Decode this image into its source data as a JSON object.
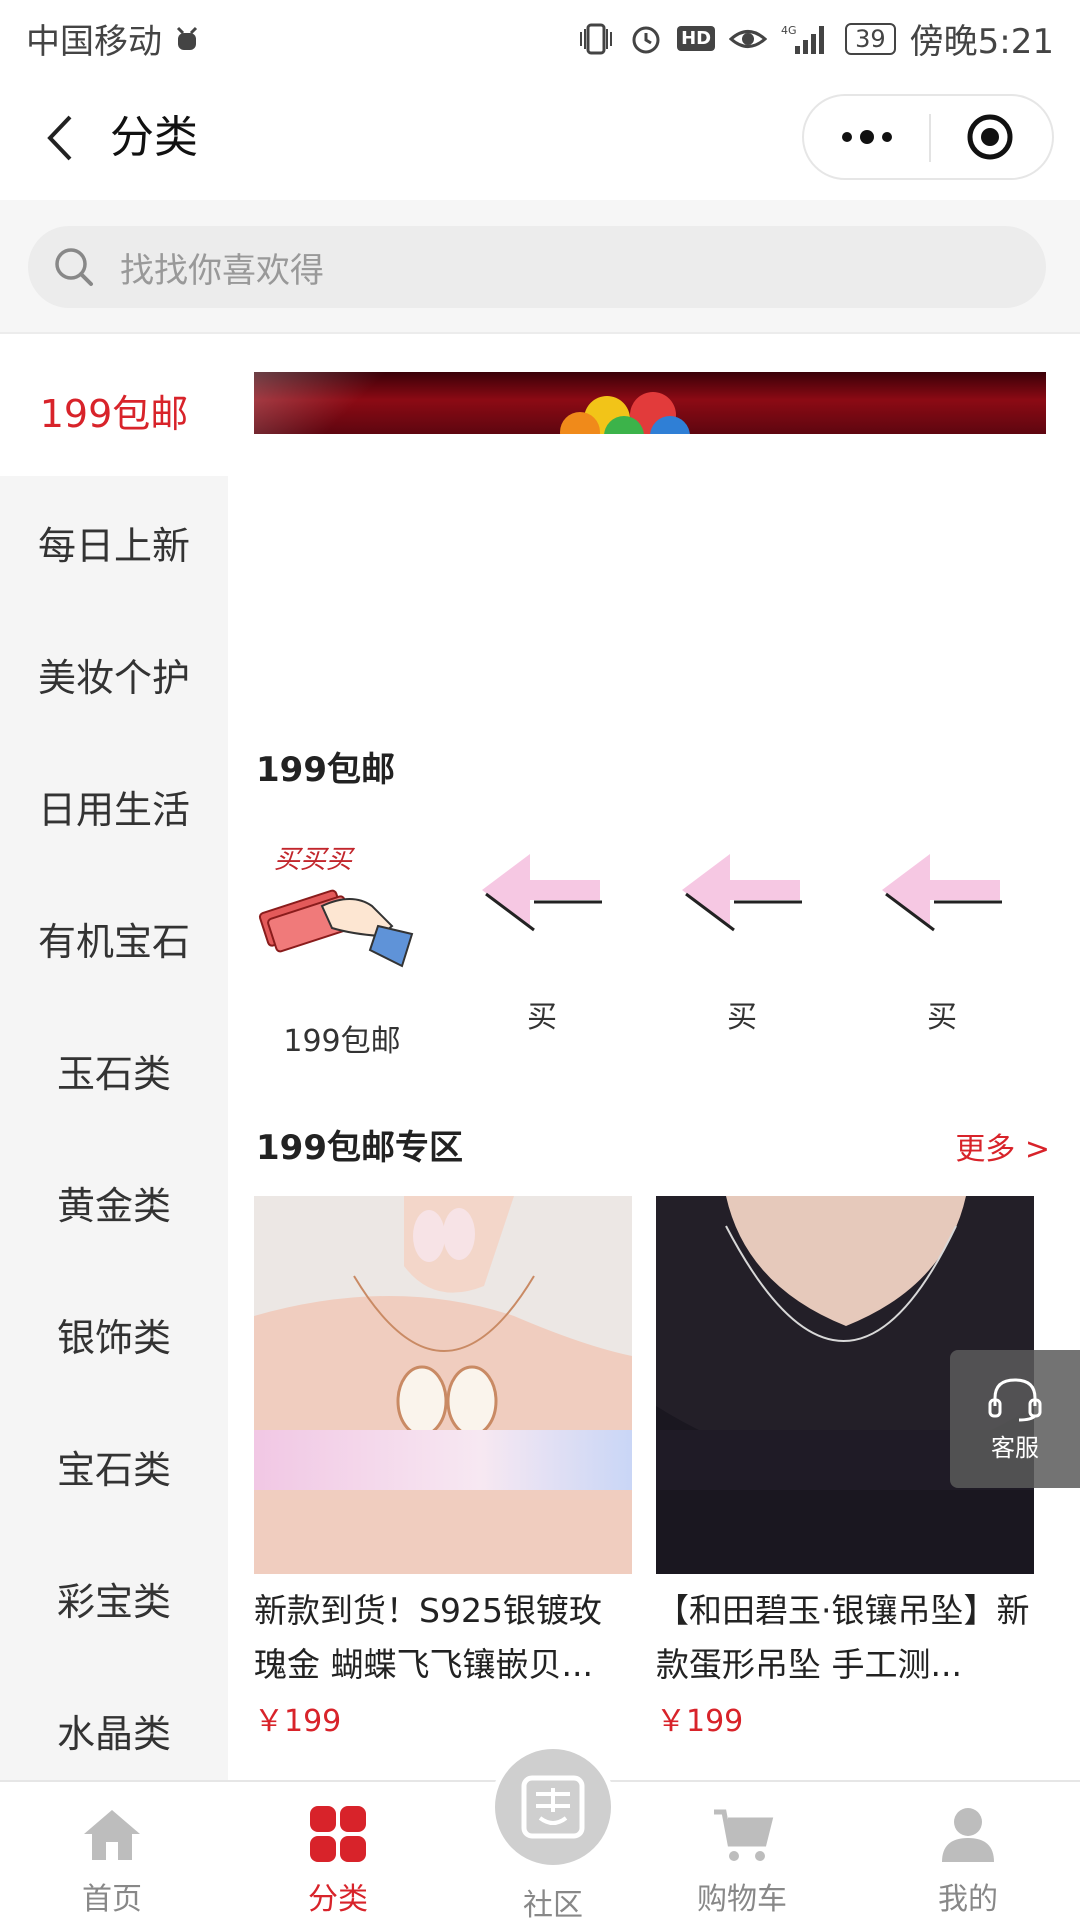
{
  "status_bar": {
    "carrier": "中国移动",
    "battery": "39",
    "time": "傍晚5:21"
  },
  "nav": {
    "title": "分类"
  },
  "search": {
    "placeholder": "找找你喜欢得"
  },
  "sidebar": {
    "items": [
      {
        "label": "199包邮",
        "active": true
      },
      {
        "label": "每日上新"
      },
      {
        "label": "美妆个护"
      },
      {
        "label": "日用生活"
      },
      {
        "label": "有机宝石"
      },
      {
        "label": "玉石类"
      },
      {
        "label": "黄金类"
      },
      {
        "label": "银饰类"
      },
      {
        "label": "宝石类"
      },
      {
        "label": "彩宝类"
      },
      {
        "label": "水晶类"
      }
    ]
  },
  "main": {
    "section1_title": "199包邮",
    "categories": [
      {
        "label": "199包邮",
        "icon": "buy-hand-icon"
      },
      {
        "label": "买",
        "icon": "arrow-left-icon"
      },
      {
        "label": "买",
        "icon": "arrow-left-icon"
      },
      {
        "label": "买",
        "icon": "arrow-left-icon"
      }
    ],
    "section2_title": "199包邮专区",
    "more_label": "更多 >",
    "products": [
      {
        "title": "新款到货！S925银镀玫瑰金 蝴蝶飞飞镶嵌贝...",
        "price": "￥199"
      },
      {
        "title": "【和田碧玉·银镶吊坠】新款蛋形吊坠 手工测...",
        "price": "￥199"
      }
    ]
  },
  "service": {
    "label": "客服"
  },
  "tab_bar": {
    "tabs": [
      {
        "label": "首页"
      },
      {
        "label": "分类",
        "active": true
      },
      {
        "label": "社区"
      },
      {
        "label": "购物车"
      },
      {
        "label": "我的"
      }
    ]
  },
  "colors": {
    "accent": "#d8232a",
    "inactive": "#888888"
  }
}
